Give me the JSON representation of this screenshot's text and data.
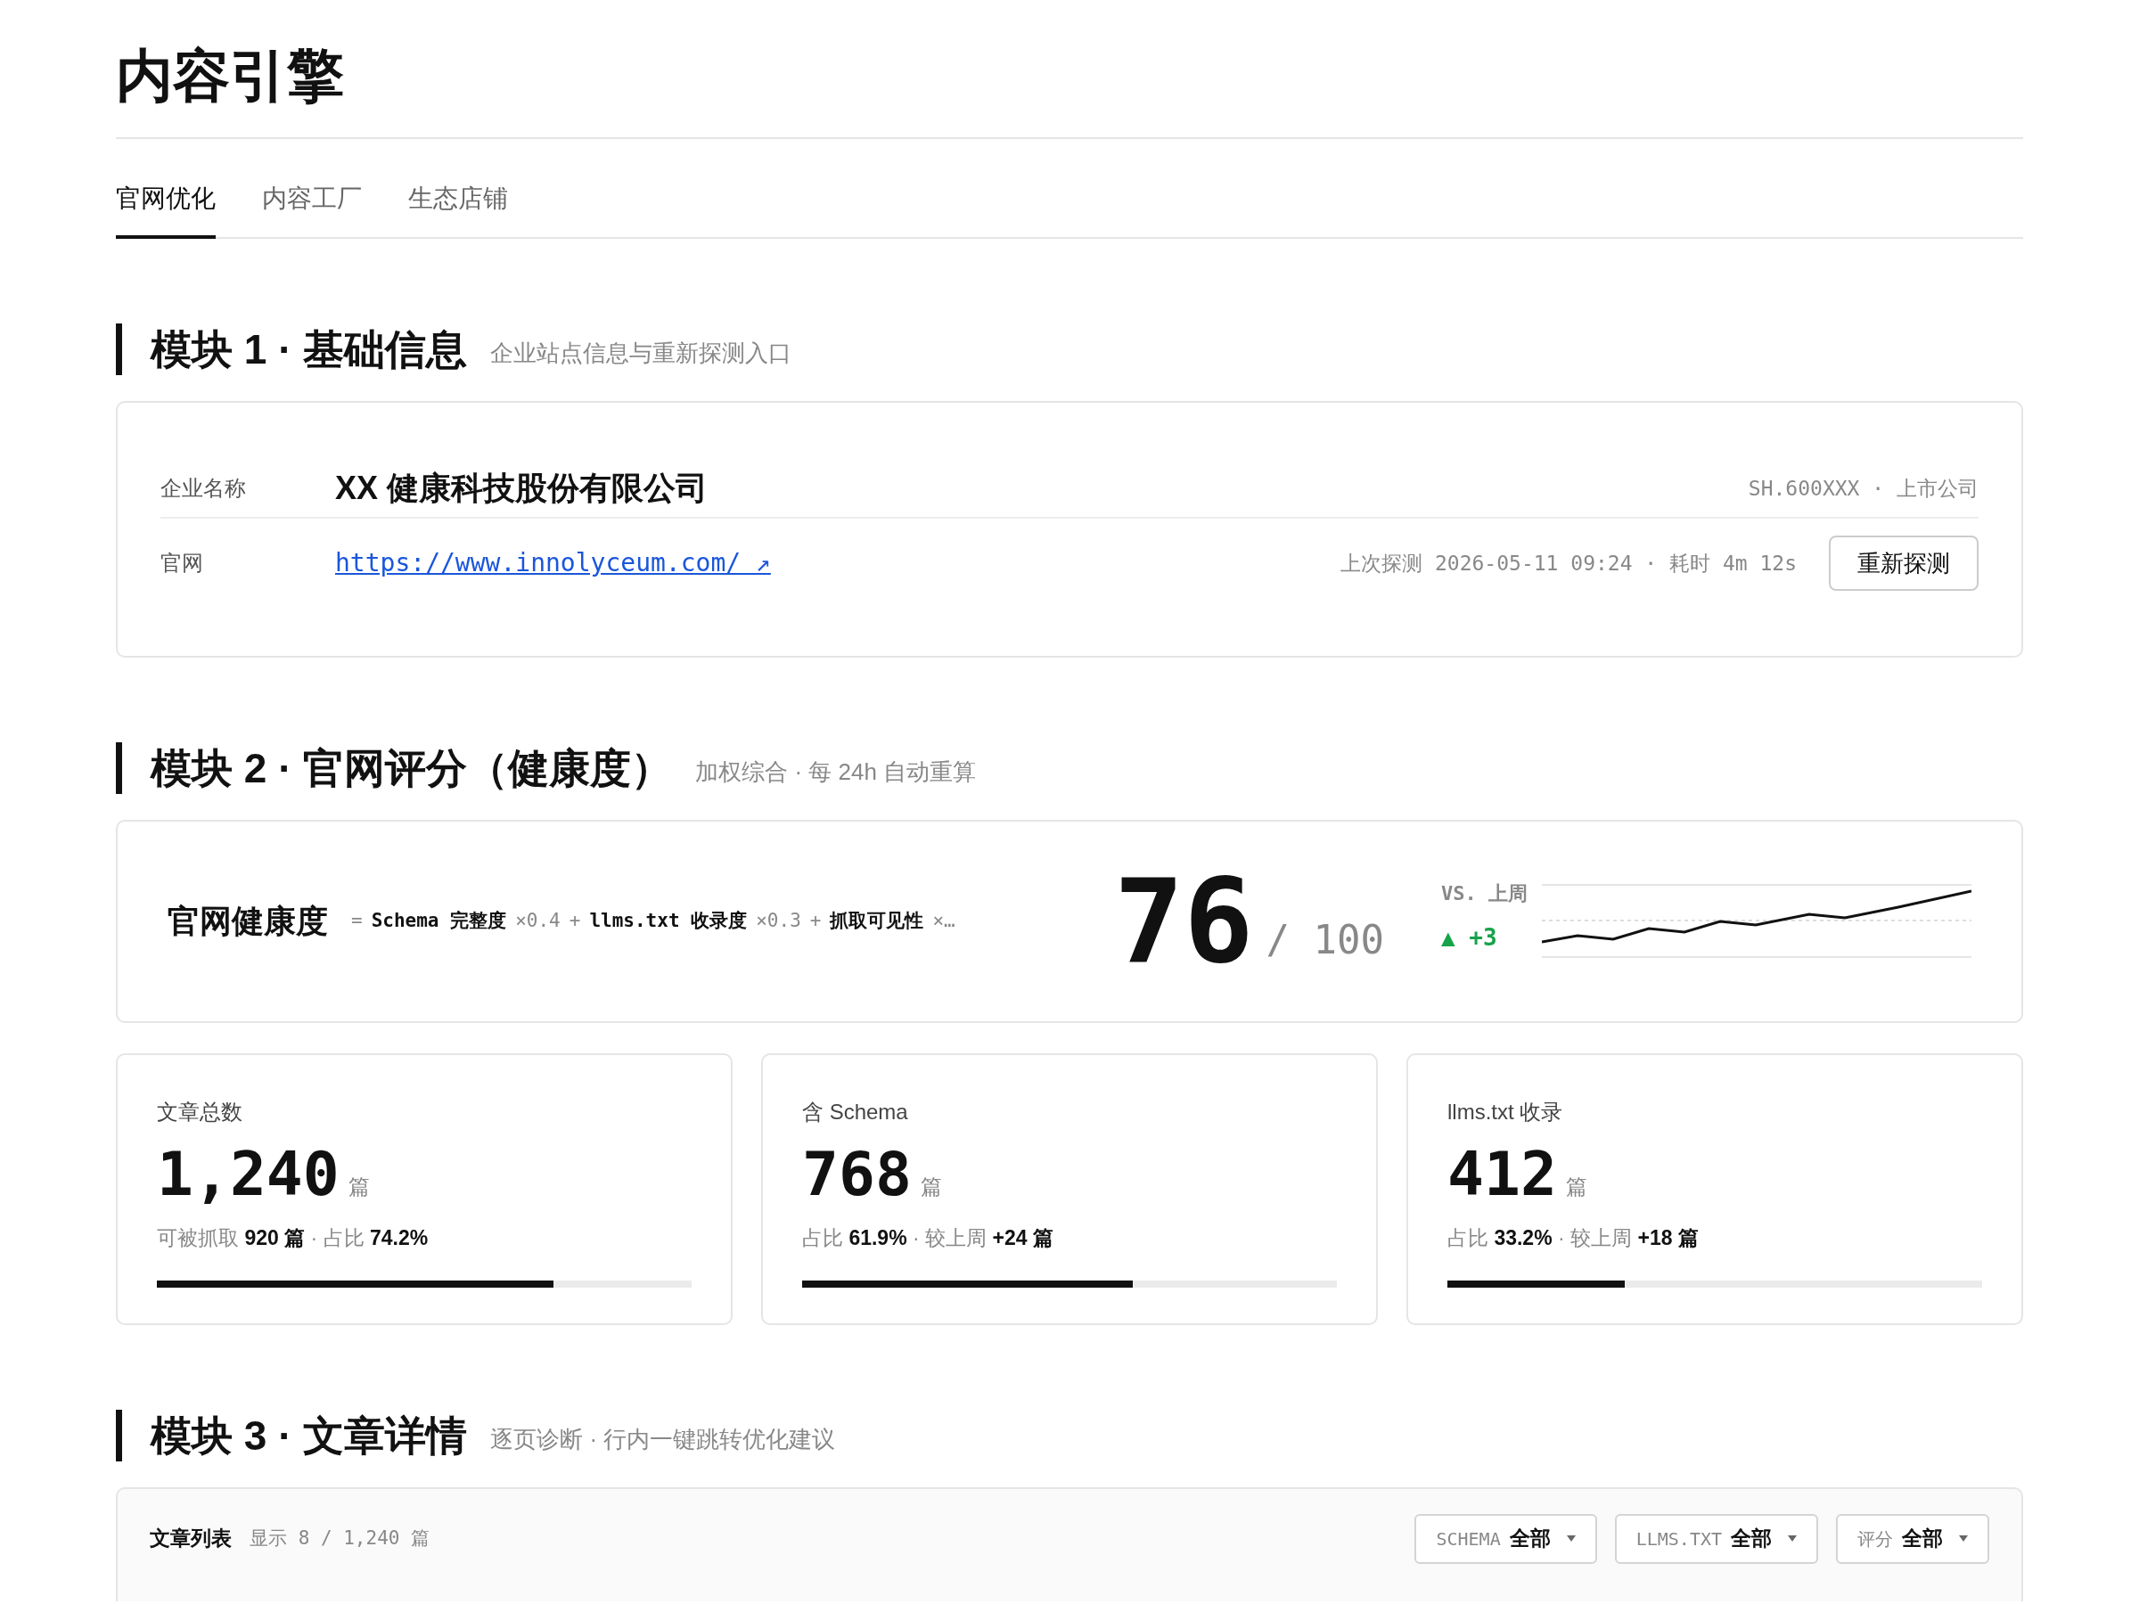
{
  "page_title": "内容引擎",
  "tabs": [
    {
      "label": "官网优化",
      "selected": true
    },
    {
      "label": "内容工厂",
      "selected": false
    },
    {
      "label": "生态店铺",
      "selected": false
    }
  ],
  "module1": {
    "heading": "模块 1 · 基础信息",
    "subtitle": "企业站点信息与重新探测入口",
    "company_label": "企业名称",
    "company_name": "XX 健康科技股份有限公司",
    "company_meta": "SH.600XXX · 上市公司",
    "site_label": "官网",
    "site_url": "https://www.innolyceum.com/ ↗",
    "probe_info": "上次探测 2026-05-11 09:24 · 耗时 4m 12s",
    "reprobe_button": "重新探测"
  },
  "module2": {
    "heading": "模块 2 · 官网评分（健康度）",
    "subtitle": "加权综合 · 每 24h 自动重算",
    "score_card": {
      "label": "官网健康度",
      "equals": "=",
      "plus": "+",
      "terms": [
        {
          "name": "Schema 完整度",
          "weight": "×0.4"
        },
        {
          "name": "llms.txt 收录度",
          "weight": "×0.3"
        },
        {
          "name": "抓取可见性",
          "weight": "×…"
        }
      ],
      "score": "76",
      "max": "/ 100",
      "compare_label": "VS. 上周",
      "delta": "▲ +3"
    },
    "stats": [
      {
        "label": "文章总数",
        "value": "1,240",
        "unit": "篇",
        "detail": "可被抓取 **920 篇** · 占比 **74.2%**",
        "level": 0.742
      },
      {
        "label": "含 Schema",
        "value": "768",
        "unit": "篇",
        "detail": "占比 **61.9%** · 较上周 **+24 篇**",
        "level": 0.619
      },
      {
        "label": "llms.txt 收录",
        "value": "412",
        "unit": "篇",
        "detail": "占比 **33.2%** · 较上周 **+18 篇**",
        "level": 0.332
      }
    ]
  },
  "module3": {
    "heading": "模块 3 · 文章详情",
    "subtitle": "逐页诊断 · 行内一键跳转优化建议",
    "list_title": "文章列表",
    "list_count": "显示 8 / 1,240 篇",
    "filters": [
      {
        "label": "SCHEMA",
        "value": "全部"
      },
      {
        "label": "LLMS.TXT",
        "value": "全部"
      },
      {
        "label": "评分",
        "value": "全部"
      }
    ]
  }
}
